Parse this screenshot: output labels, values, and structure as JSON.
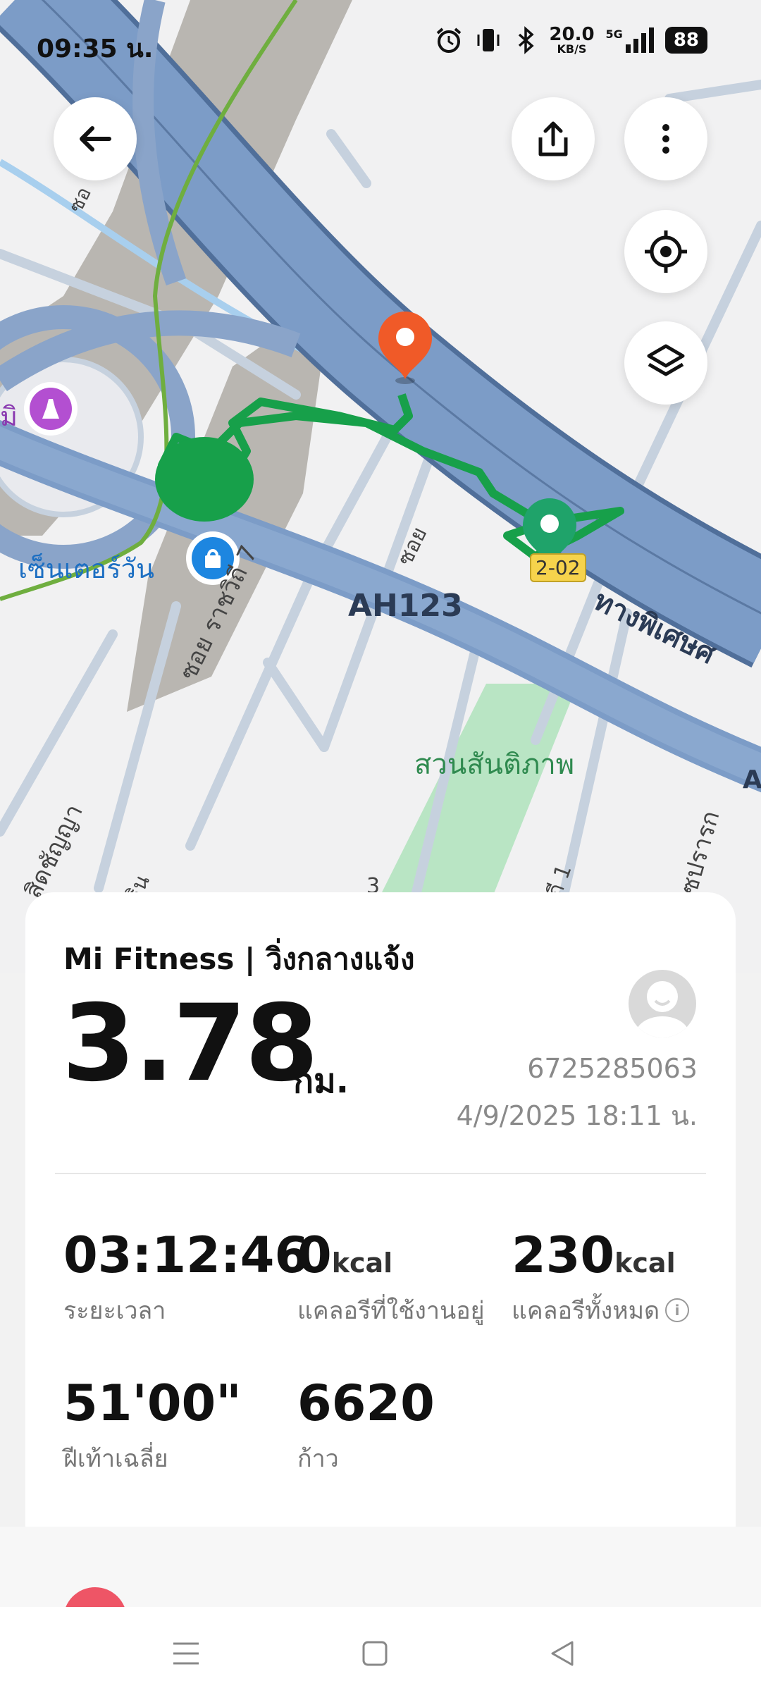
{
  "status_bar": {
    "time": "09:35 น.",
    "net_speed": "20.0",
    "net_unit": "KB/S",
    "network": "5G",
    "battery": "88",
    "icons": [
      "alarm-icon",
      "vibrate-icon",
      "bluetooth-icon",
      "5g-signal-icon",
      "battery-icon"
    ]
  },
  "map": {
    "labels": {
      "center_one": "เซ็นเตอร์วัน",
      "road_ah123": "AH123",
      "park": "สวนสันติภาพ",
      "soi_rajavithi": "ซอย ราชวิถี 7",
      "expressway": "ทางพิเศษศ",
      "route_badge": "2-02",
      "soi_short": "ซอย",
      "victory": "มิ",
      "road_left": "สิดชัญญา",
      "road_bottom_left": "ธิน",
      "road_bottom_right": "ซปรารก",
      "num_3": "3",
      "num_1": "ถี 1",
      "corner": "A",
      "soi_top": "ซอ"
    },
    "colors": {
      "expressway": "#7c9cc7",
      "route": "#17a04a",
      "park": "#b9e5c4",
      "building": "#b9b6b1",
      "end_pin": "#f05a28",
      "start_pin": "#1fa36a"
    }
  },
  "buttons": {
    "icons": [
      "back-arrow-icon",
      "share-icon",
      "more-vert-icon",
      "locate-icon",
      "layers-icon"
    ]
  },
  "card": {
    "title": "Mi Fitness | วิ่งกลางแจ้ง",
    "distance": "3.78",
    "distance_unit": "กม.",
    "user_id": "6725285063",
    "date": "4/9/2025 18:11 น.",
    "stats": {
      "duration": {
        "value": "03:12:46",
        "label": "ระยะเวลา"
      },
      "active_cal": {
        "value": "0",
        "unit": "kcal",
        "label": "แคลอรีที่ใช้งานอยู่"
      },
      "total_cal": {
        "value": "230",
        "unit": "kcal",
        "label": "แคลอรีทั้งหมด"
      },
      "pace": {
        "value": "51'00\"",
        "label": "ฝีเท้าเฉลี่ย"
      },
      "steps": {
        "value": "6620",
        "label": "ก้าว"
      }
    }
  },
  "navbar": {
    "icons": [
      "menu-icon",
      "home-square-icon",
      "back-triangle-icon"
    ]
  }
}
